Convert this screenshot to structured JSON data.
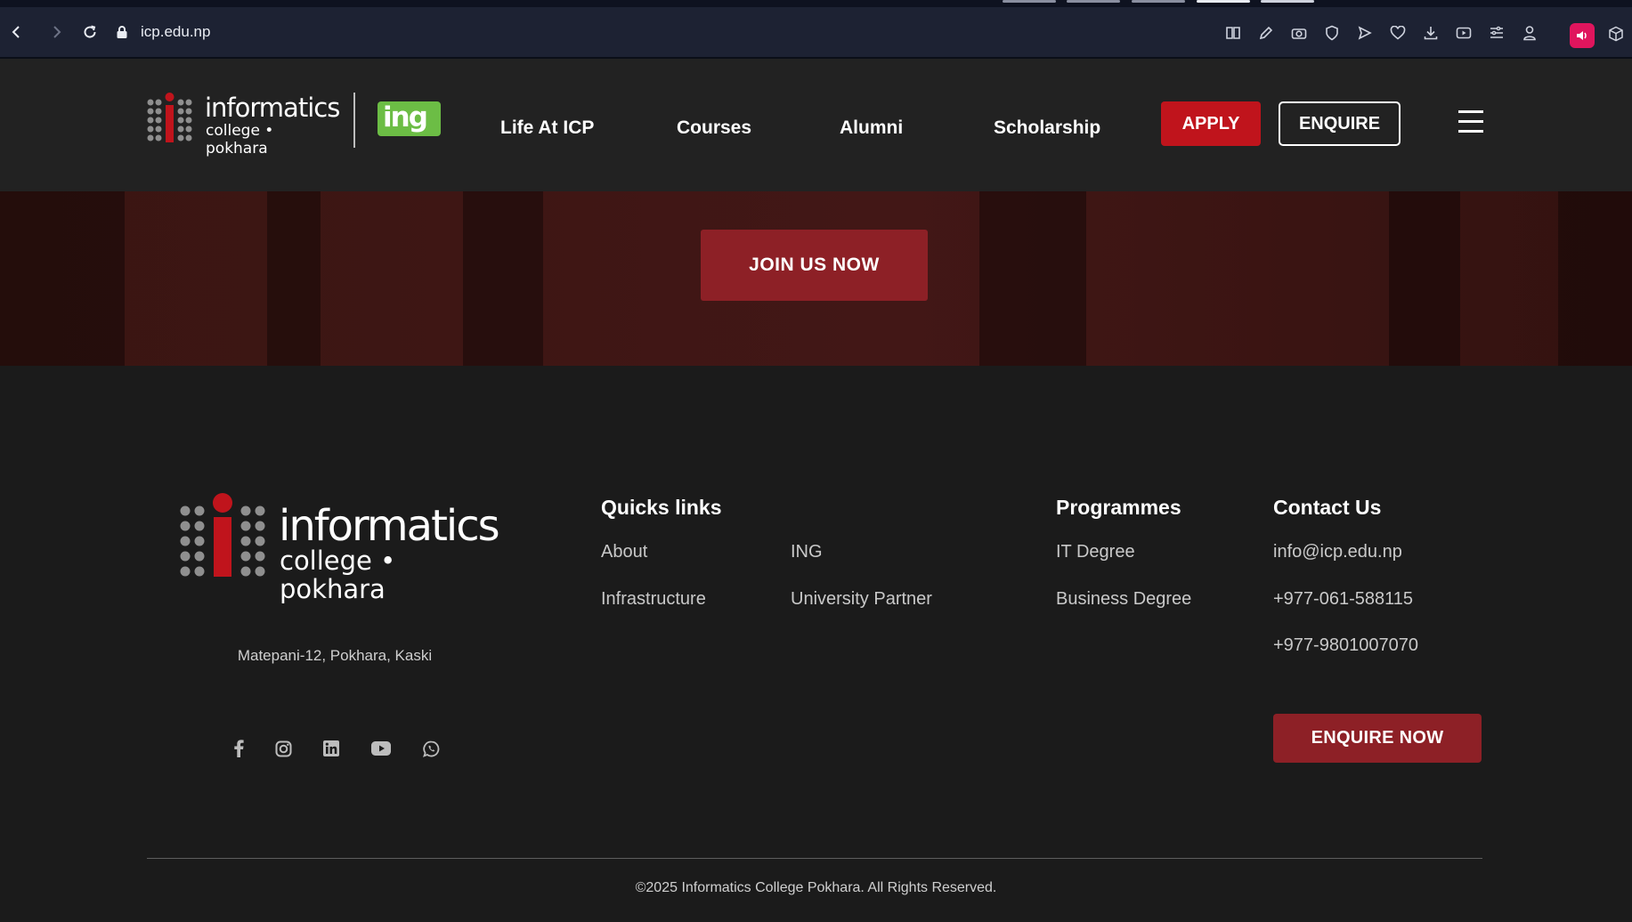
{
  "browser": {
    "url": "icp.edu.np"
  },
  "header": {
    "logo_text_main": "informatics",
    "logo_text_sub": "college • pokhara",
    "ing_badge": "ing",
    "nav": [
      {
        "label": "Life At ICP"
      },
      {
        "label": "Courses"
      },
      {
        "label": "Alumni"
      },
      {
        "label": "Scholarship"
      }
    ],
    "apply_label": "APPLY",
    "enquire_label": "ENQUIRE"
  },
  "hero": {
    "cta_label": "JOIN US NOW"
  },
  "footer": {
    "logo_text_main": "informatics",
    "logo_text_sub": "college • pokhara",
    "address": "Matepani-12, Pokhara, Kaski",
    "socials": [
      "facebook-icon",
      "instagram-icon",
      "linkedin-icon",
      "youtube-icon",
      "whatsapp-icon"
    ],
    "quick_links": {
      "title": "Quicks links",
      "items": [
        "About",
        "ING",
        "Infrastructure",
        "University Partner"
      ]
    },
    "programmes": {
      "title": "Programmes",
      "items": [
        "IT Degree",
        "Business Degree"
      ]
    },
    "contact": {
      "title": "Contact Us",
      "email": "info@icp.edu.np",
      "phone1": "+977-061-588115",
      "phone2": "+977-9801007070"
    },
    "enquire_now_label": "ENQUIRE NOW",
    "copyright": "©2025 Informatics College Pokhara. All Rights Reserved."
  },
  "colors": {
    "brand_red": "#c0141c",
    "button_maroon": "#8d2026",
    "ing_green": "#6cbd45",
    "header_bg": "#222222",
    "footer_bg": "#1b1b1b"
  }
}
